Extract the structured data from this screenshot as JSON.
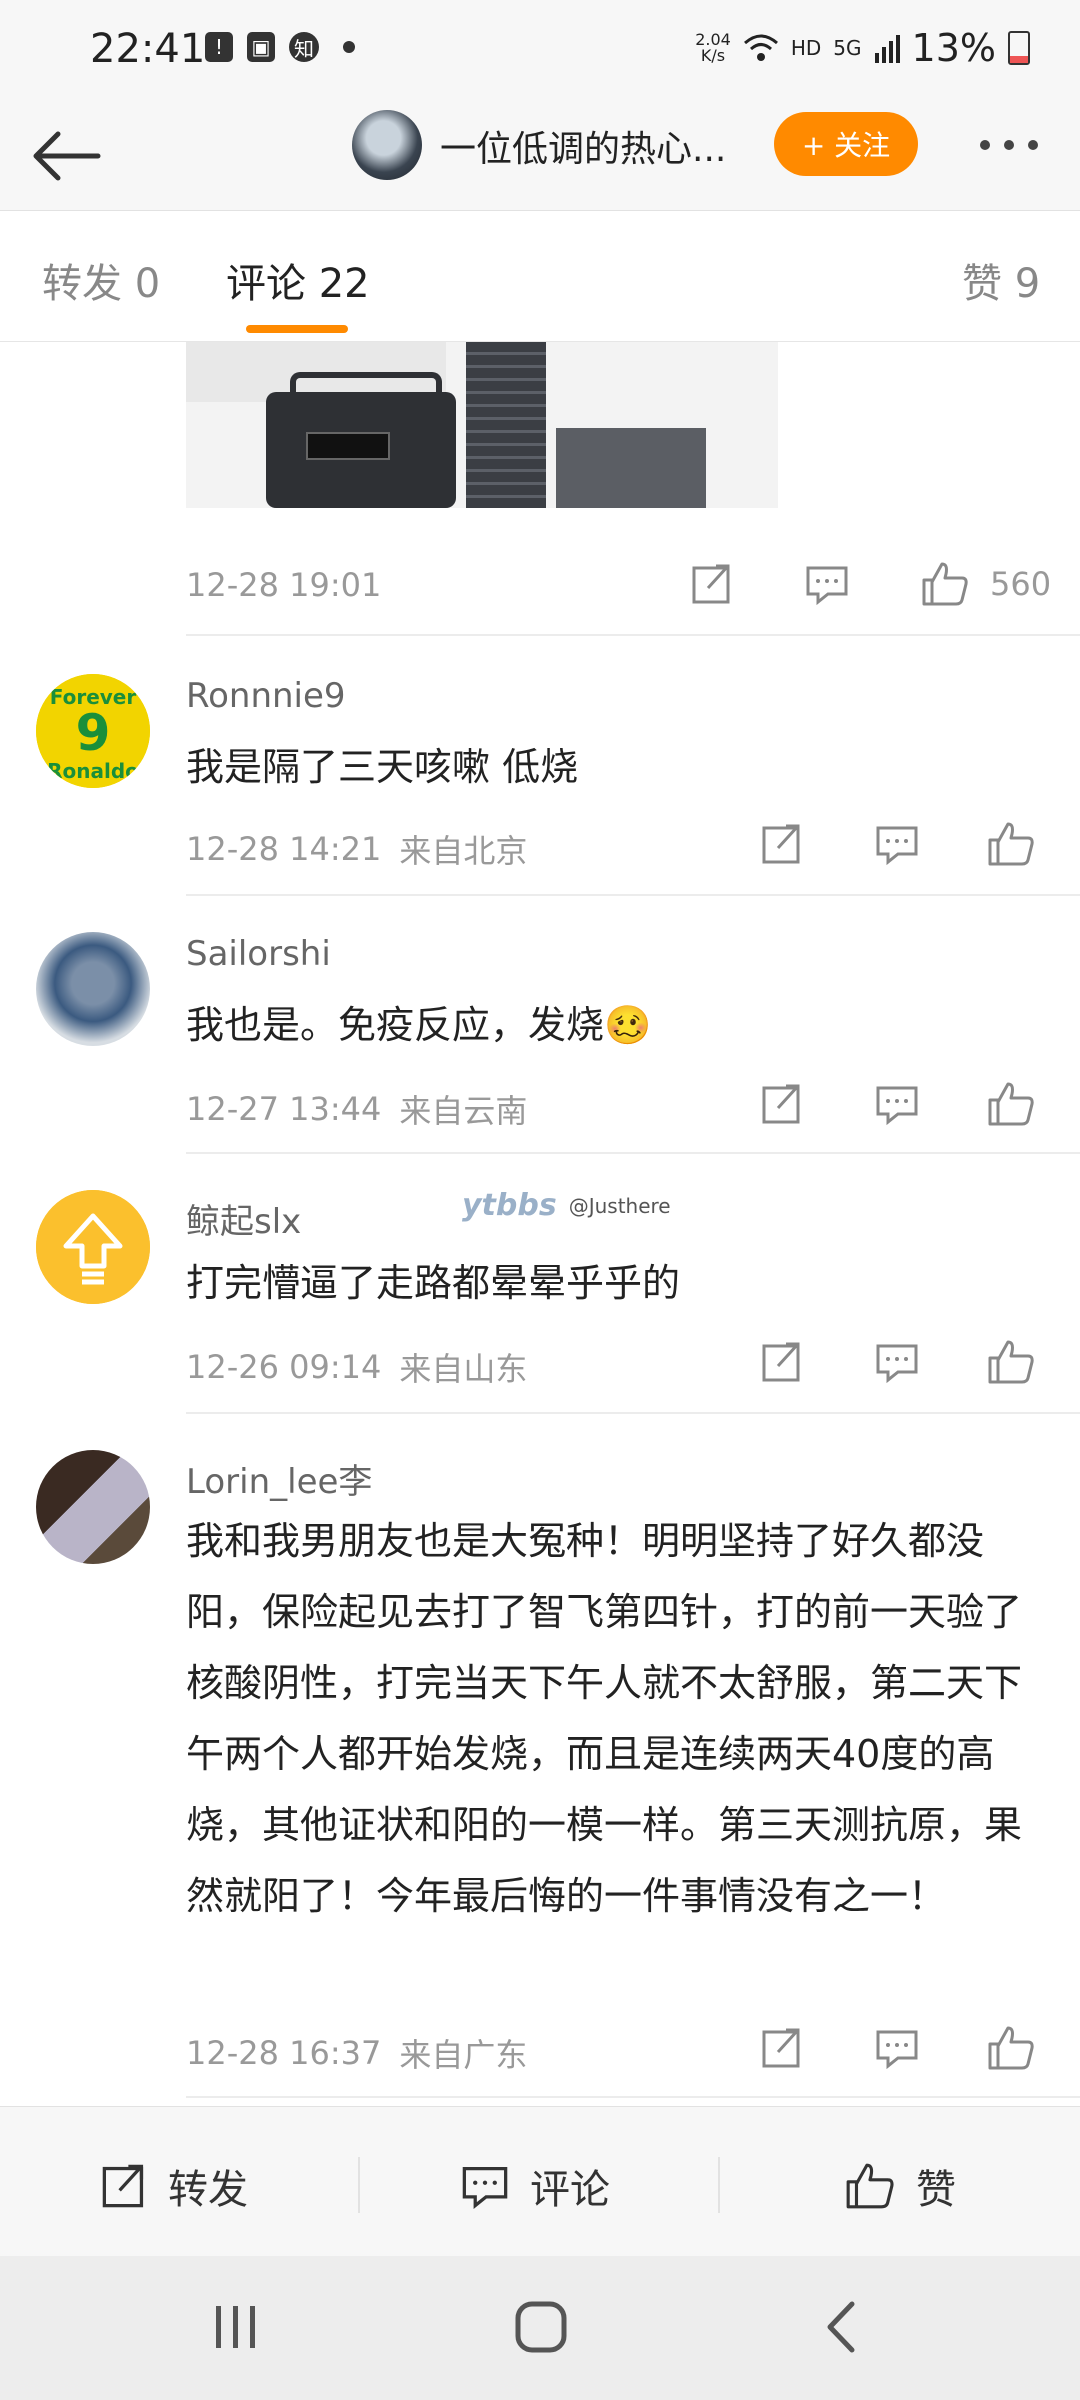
{
  "status_bar": {
    "time": "22:41",
    "speed_value": "2.04",
    "speed_unit": "K/s",
    "network": "HD",
    "signal": "5G",
    "battery": "13%"
  },
  "header": {
    "username": "一位低调的热心...",
    "follow_label": "+ 关注"
  },
  "tabs": [
    {
      "label": "转发 0"
    },
    {
      "label": "评论 22"
    },
    {
      "label": "赞 9"
    }
  ],
  "post": {
    "timestamp": "12-28 19:01",
    "like_count": "560"
  },
  "comments": [
    {
      "username": "Ronnnie9",
      "text": "我是隔了三天咳嗽 低烧",
      "time": "12-28 14:21",
      "location": "来自北京"
    },
    {
      "username": "Sailorshi",
      "text": "我也是。免疫反应，发烧🥴",
      "time": "12-27 13:44",
      "location": "来自云南"
    },
    {
      "username": "鲸起slx",
      "text": "打完懵逼了走路都晕晕乎乎的",
      "time": "12-26 09:14",
      "location": "来自山东"
    },
    {
      "username": "Lorin_lee李",
      "text": "我和我男朋友也是大冤种！明明坚持了好久都没阳，保险起见去打了智飞第四针，打的前一天验了核酸阴性，打完当天下午人就不太舒服，第二天下午两个人都开始发烧，而且是连续两天40度的高烧，其他证状和阳的一模一样。第三天测抗原，果然就阳了！今年最后悔的一件事情没有之一！",
      "time": "12-28 16:37",
      "location": "来自广东"
    }
  ],
  "avatar_labels": {
    "forever": "Forever",
    "nine": "9",
    "ronald": "Ronaldo"
  },
  "watermark": {
    "site": "ytbbs",
    "handle": "@Justhere"
  },
  "bottom_bar": {
    "repost": "转发",
    "comment": "评论",
    "like": "赞"
  },
  "colors": {
    "accent": "#ff8a00",
    "text": "#222222",
    "muted": "#999999"
  }
}
